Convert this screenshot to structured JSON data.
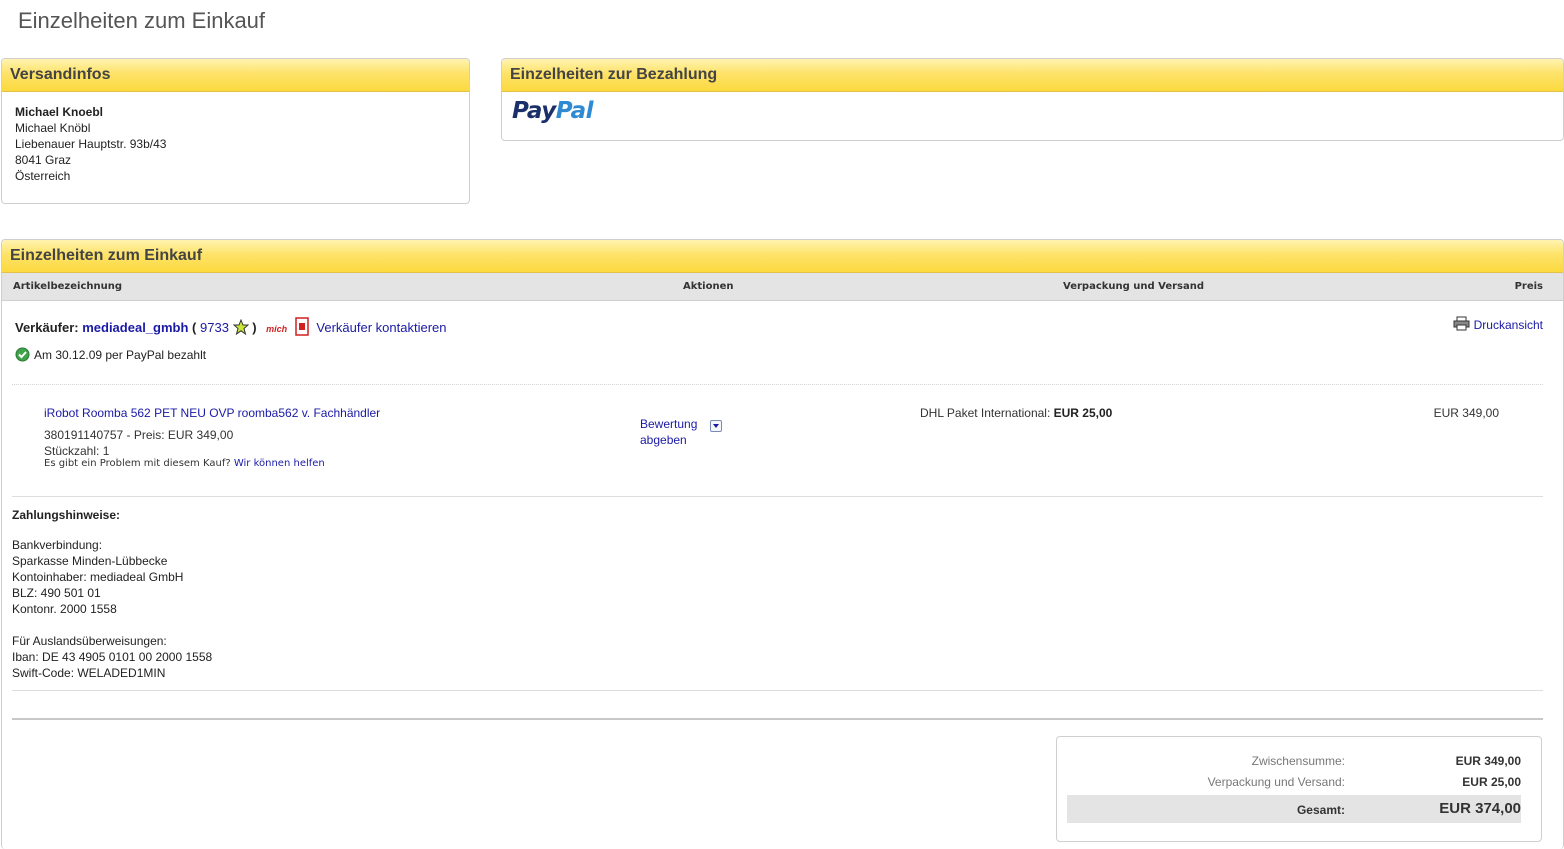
{
  "page": {
    "title": "Einzelheiten zum Einkauf"
  },
  "shipping": {
    "header": "Versandinfos",
    "name": "Michael Knoebl",
    "lines": [
      "Michael Knöbl",
      "Liebenauer Hauptstr. 93b/43",
      "8041 Graz",
      "Österreich"
    ]
  },
  "payment": {
    "header": "Einzelheiten zur Bezahlung",
    "logo_part1": "Pay",
    "logo_part2": "Pal"
  },
  "purchase": {
    "header": "Einzelheiten zum Einkauf",
    "columns": {
      "item": "Artikelbezeichnung",
      "actions": "Aktionen",
      "shipping": "Verpackung und Versand",
      "price": "Preis"
    },
    "seller_label": "Verkäufer:",
    "seller_name": "mediadeal_gmbh",
    "seller_open": "(",
    "seller_score": "9733",
    "seller_close": ")",
    "me_badge": "mich",
    "contact_link": "Verkäufer kontaktieren",
    "print_link": "Druckansicht",
    "paid_status": "Am 30.12.09 per PayPal bezahlt",
    "item": {
      "title": "iRobot Roomba 562 PET NEU OVP roomba562 v. Fachhändler",
      "id_price": "380191140757 - Preis: EUR 349,00",
      "quantity": "Stückzahl: 1",
      "problem_text": "Es gibt ein Problem mit diesem Kauf?",
      "help_link": "Wir können helfen",
      "rate_link_line1": "Bewertung",
      "rate_link_line2": "abgeben",
      "ship_method": "DHL Paket International:",
      "ship_cost": "EUR 25,00",
      "price": "EUR 349,00"
    },
    "payment_notes": {
      "title": "Zahlungshinweise:",
      "lines": [
        "Bankverbindung:",
        "Sparkasse Minden-Lübbecke",
        "Kontoinhaber: mediadeal GmbH",
        "BLZ: 490 501 01",
        "Kontonr. 2000 1558",
        "",
        "Für Auslandsüberweisungen:",
        "Iban: DE 43 4905 0101 00 2000 1558",
        "Swift-Code: WELADED1MIN"
      ]
    },
    "totals": {
      "subtotal_label": "Zwischensumme:",
      "subtotal_value": "EUR 349,00",
      "shipping_label": "Verpackung und Versand:",
      "shipping_value": "EUR 25,00",
      "total_label": "Gesamt:",
      "total_value": "EUR 374,00"
    }
  },
  "colors": {
    "header_yellow": "#fbd93e",
    "link_blue": "#1a1aa6",
    "paypal_dark": "#1b2f6b",
    "paypal_light": "#2d8ad3"
  }
}
